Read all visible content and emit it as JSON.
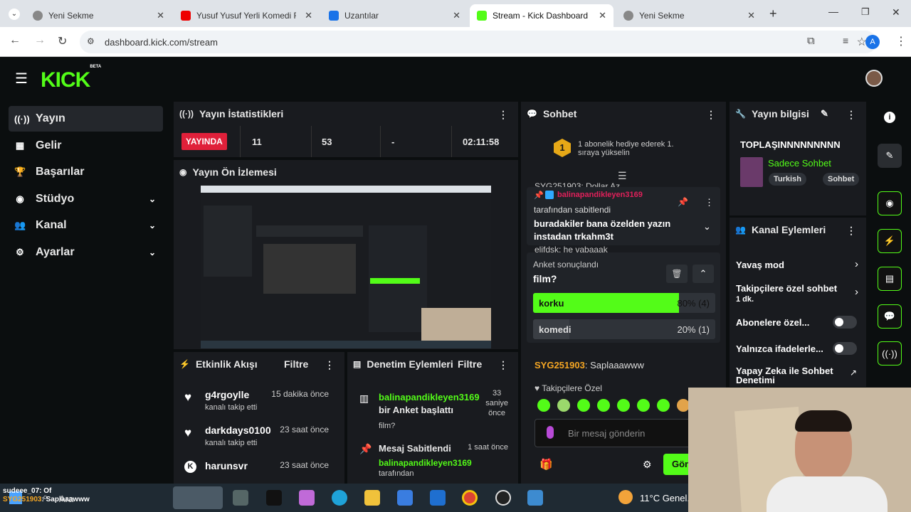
{
  "browser": {
    "tabs": [
      {
        "title": "Yeni Sekme"
      },
      {
        "title": "Yusuf Yusuf Yerli Komedi Film"
      },
      {
        "title": "Uzantılar"
      },
      {
        "title": "Stream - Kick Dashboard"
      },
      {
        "title": "Yeni Sekme"
      }
    ],
    "url": "dashboard.kick.com/stream",
    "profile_initial": "A"
  },
  "app": {
    "logo": "KICK",
    "logo_badge": "BETA"
  },
  "sidebar": {
    "items": [
      {
        "label": "Yayın",
        "icon": "broadcast-icon"
      },
      {
        "label": "Gelir",
        "icon": "chart-icon"
      },
      {
        "label": "Başarılar",
        "icon": "trophy-icon"
      },
      {
        "label": "Stüdyo",
        "icon": "camera-icon"
      },
      {
        "label": "Kanal",
        "icon": "people-icon"
      },
      {
        "label": "Ayarlar",
        "icon": "gear-icon"
      }
    ]
  },
  "stats": {
    "title": "Yayın İstatistikleri",
    "live_badge": "YAYINDA",
    "viewers": "11",
    "followers": "53",
    "subs": "-",
    "duration": "02:11:58"
  },
  "preview": {
    "title": "Yayın Ön İzlemesi"
  },
  "activity": {
    "title": "Etkinlik Akışı",
    "filter": "Filtre",
    "items": [
      {
        "name": "g4rgoylle",
        "sub": "kanalı takip etti",
        "time": "15 dakika önce"
      },
      {
        "name": "darkdays0100",
        "sub": "kanalı takip etti",
        "time": "23 saat önce"
      },
      {
        "name": "harunsvr",
        "sub": "",
        "time": "23 saat önce"
      }
    ]
  },
  "moderation": {
    "title": "Denetim Eylemleri",
    "filter": "Filtre",
    "items": [
      {
        "user": "balinapandikleyen3169",
        "action": "bir Anket başlattı",
        "detail": "film?",
        "time_1": "33",
        "time_2": "saniye",
        "time_3": "önce"
      },
      {
        "action": "Mesaj Sabitlendi",
        "user": "balinapandikleyen3169",
        "detail": "tarafından",
        "time": "1 saat önce"
      }
    ]
  },
  "chat": {
    "title": "Sohbet",
    "gift_banner": "1 abonelik hediye ederek 1. sıraya yükselin",
    "gift_rank": "1",
    "behind_1": "SYG251903: Dollar Az...",
    "behind_2": "elifdsk: he vabaaak",
    "behind_3": "sudeee_07: Of",
    "pinned": {
      "user": "balinapandikleyen3169",
      "by": "tarafından sabitlendi",
      "text": "buradakiler bana özelden yazın instadan trkahm3t"
    },
    "poll": {
      "status": "Anket sonuçlandı",
      "question": "film?",
      "options": [
        {
          "label": "korku",
          "result": "80% (4)",
          "fraction": 0.8
        },
        {
          "label": "komedi",
          "result": "20% (1)",
          "fraction": 0.2
        }
      ]
    },
    "message": {
      "user": "SYG251903",
      "text": ": Saplaaawww"
    },
    "followers_only": "Takipçilere Özel",
    "input_placeholder": "Bir mesaj gönderin",
    "send": "Gönder"
  },
  "stream_info": {
    "title": "Yayın bilgisi",
    "stream_title": "TOPLAŞINNNNNNNNN",
    "category": "Sadece Sohbet",
    "tags": [
      "Turkish",
      "Sohbet"
    ]
  },
  "channel_actions": {
    "title": "Kanal Eylemleri",
    "items": [
      {
        "label": "Yavaş mod",
        "sub": ""
      },
      {
        "label": "Takipçilere özel sohbet",
        "sub": "1 dk."
      },
      {
        "label": "Abonelere özel...",
        "sub": ""
      },
      {
        "label": "Yalnızca ifadelerle...",
        "sub": ""
      },
      {
        "label": "Yapay Zeka ile Sohbet Denetimi",
        "sub": ""
      }
    ]
  },
  "overlay": {
    "user": "sudeee_07",
    "text": ": Of",
    "user2": "SYG251903",
    "text2": ": Saplaaawww"
  },
  "taskbar": {
    "search": "Ara",
    "weather": "11°C  Genel..."
  }
}
